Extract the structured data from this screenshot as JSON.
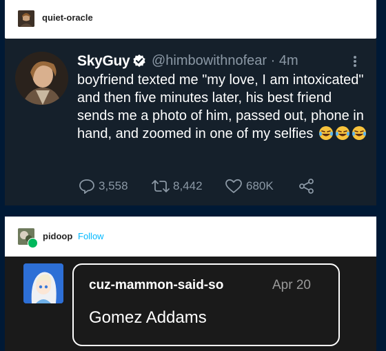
{
  "post1": {
    "blog_name": "quiet-oracle",
    "tweet": {
      "name": "SkyGuy",
      "handle": "@himbowithnofear",
      "time": "· 4m",
      "text": "boyfriend texted me \"my love, I am intoxicated\" and then five minutes later, his best friend sends me a photo of him, passed out, phone in hand, and zoomed in one of my selfies",
      "emoji": "😂😂😂",
      "replies": "3,558",
      "retweets": "8,442",
      "likes": "680K"
    }
  },
  "post2": {
    "blog_name": "pidoop",
    "follow_label": "Follow",
    "reblog": {
      "username": "cuz-mammon-said-so",
      "date": "Apr 20",
      "text": "Gomez Addams"
    }
  },
  "colors": {
    "tweet_bg": "#15202b",
    "tweet_secondary": "#8b98a5",
    "follow_link": "#00b8ff",
    "page_bg": "#001935"
  },
  "icons": [
    "verified-badge-icon",
    "more-options-icon",
    "reply-icon",
    "retweet-icon",
    "like-icon",
    "share-icon",
    "laughing-emoji-icon"
  ]
}
